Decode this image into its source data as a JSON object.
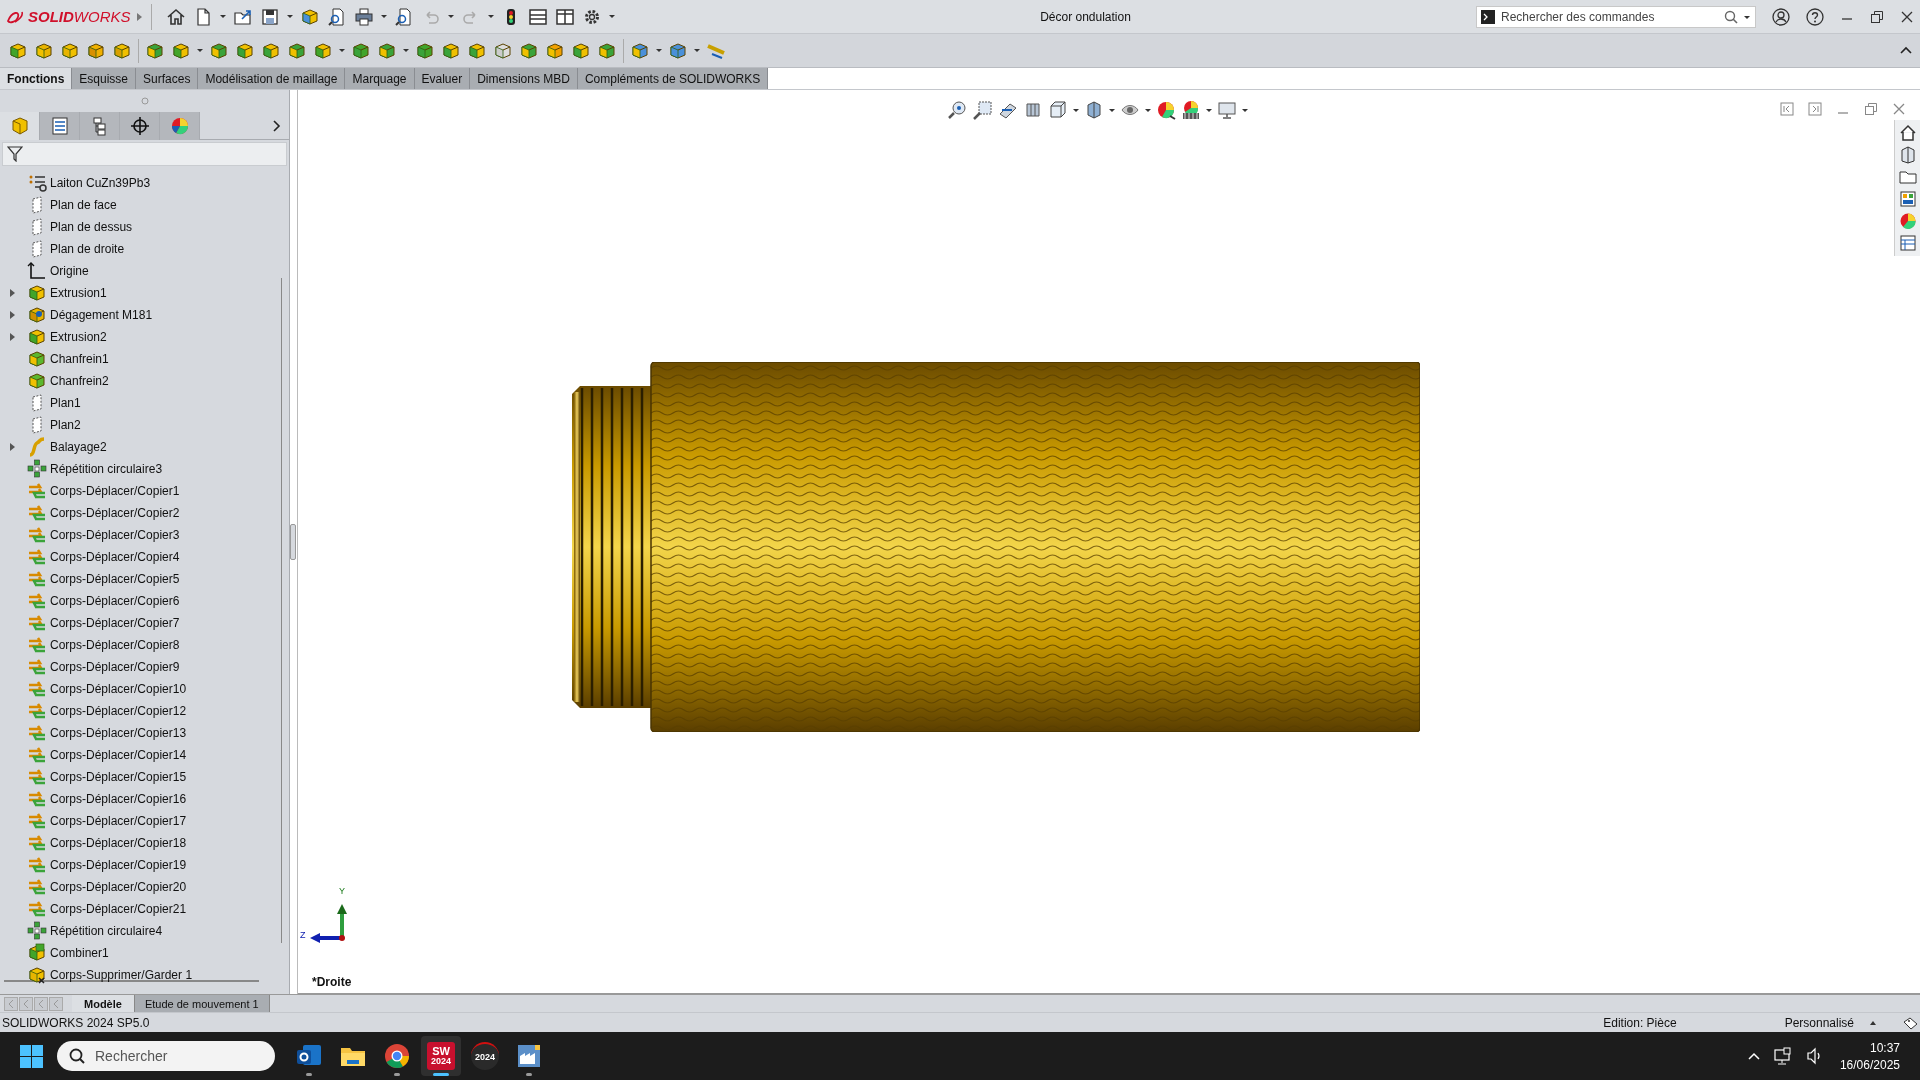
{
  "app": {
    "logo": "**SOLID**WORKS",
    "title": "Décor ondulation",
    "search": {
      "placeholder": "Rechercher des commandes"
    }
  },
  "command_tabs": [
    {
      "label": "Fonctions",
      "selected": true
    },
    {
      "label": "Esquisse",
      "selected": false
    },
    {
      "label": "Surfaces",
      "selected": false
    },
    {
      "label": "Modélisation de maillage",
      "selected": false
    },
    {
      "label": "Marquage",
      "selected": false
    },
    {
      "label": "Evaluer",
      "selected": false
    },
    {
      "label": "Dimensions MBD",
      "selected": false
    },
    {
      "label": "Compléments de SOLIDWORKS",
      "selected": false
    }
  ],
  "panel_tabs": [
    {
      "kind": "features",
      "selected": true
    },
    {
      "kind": "properties",
      "selected": false
    },
    {
      "kind": "configurations",
      "selected": false
    },
    {
      "kind": "dimxpert",
      "selected": false
    },
    {
      "kind": "appearance",
      "selected": false
    }
  ],
  "feature_tree": {
    "items": [
      {
        "label": "Laiton CuZn39Pb3",
        "kind": "material",
        "collapsed": false
      },
      {
        "label": "Plan de face",
        "kind": "plane",
        "collapsed": false
      },
      {
        "label": "Plan de dessus",
        "kind": "plane",
        "collapsed": false
      },
      {
        "label": "Plan de droite",
        "kind": "plane",
        "collapsed": false
      },
      {
        "label": "Origine",
        "kind": "origin",
        "collapsed": false
      },
      {
        "label": "Extrusion1",
        "kind": "extrude",
        "collapsed": true
      },
      {
        "label": "Dégagement M181",
        "kind": "hole",
        "collapsed": true
      },
      {
        "label": "Extrusion2",
        "kind": "extrude",
        "collapsed": true
      },
      {
        "label": "Chanfrein1",
        "kind": "chamfer",
        "collapsed": false
      },
      {
        "label": "Chanfrein2",
        "kind": "chamfer",
        "collapsed": false
      },
      {
        "label": "Plan1",
        "kind": "plane",
        "collapsed": false
      },
      {
        "label": "Plan2",
        "kind": "plane",
        "collapsed": false
      },
      {
        "label": "Balayage2",
        "kind": "sweep",
        "collapsed": true
      },
      {
        "label": "Répétition circulaire3",
        "kind": "pattern",
        "collapsed": false
      },
      {
        "label": "Corps-Déplacer/Copier1",
        "kind": "move",
        "collapsed": false
      },
      {
        "label": "Corps-Déplacer/Copier2",
        "kind": "move",
        "collapsed": false
      },
      {
        "label": "Corps-Déplacer/Copier3",
        "kind": "move",
        "collapsed": false
      },
      {
        "label": "Corps-Déplacer/Copier4",
        "kind": "move",
        "collapsed": false
      },
      {
        "label": "Corps-Déplacer/Copier5",
        "kind": "move",
        "collapsed": false
      },
      {
        "label": "Corps-Déplacer/Copier6",
        "kind": "move",
        "collapsed": false
      },
      {
        "label": "Corps-Déplacer/Copier7",
        "kind": "move",
        "collapsed": false
      },
      {
        "label": "Corps-Déplacer/Copier8",
        "kind": "move",
        "collapsed": false
      },
      {
        "label": "Corps-Déplacer/Copier9",
        "kind": "move",
        "collapsed": false
      },
      {
        "label": "Corps-Déplacer/Copier10",
        "kind": "move",
        "collapsed": false
      },
      {
        "label": "Corps-Déplacer/Copier12",
        "kind": "move",
        "collapsed": false
      },
      {
        "label": "Corps-Déplacer/Copier13",
        "kind": "move",
        "collapsed": false
      },
      {
        "label": "Corps-Déplacer/Copier14",
        "kind": "move",
        "collapsed": false
      },
      {
        "label": "Corps-Déplacer/Copier15",
        "kind": "move",
        "collapsed": false
      },
      {
        "label": "Corps-Déplacer/Copier16",
        "kind": "move",
        "collapsed": false
      },
      {
        "label": "Corps-Déplacer/Copier17",
        "kind": "move",
        "collapsed": false
      },
      {
        "label": "Corps-Déplacer/Copier18",
        "kind": "move",
        "collapsed": false
      },
      {
        "label": "Corps-Déplacer/Copier19",
        "kind": "move",
        "collapsed": false
      },
      {
        "label": "Corps-Déplacer/Copier20",
        "kind": "move",
        "collapsed": false
      },
      {
        "label": "Corps-Déplacer/Copier21",
        "kind": "move",
        "collapsed": false
      },
      {
        "label": "Répétition circulaire4",
        "kind": "pattern",
        "collapsed": false
      },
      {
        "label": "Combiner1",
        "kind": "combine",
        "collapsed": false
      },
      {
        "label": "Corps-Supprimer/Garder 1",
        "kind": "delete",
        "collapsed": false
      }
    ]
  },
  "viewport": {
    "view_name": "*Droite",
    "triad": {
      "y_label": "Y",
      "z_label": "Z"
    }
  },
  "bottom_tabs": [
    {
      "label": "Modèle",
      "selected": true
    },
    {
      "label": "Etude de mouvement 1",
      "selected": false
    }
  ],
  "status_bar": {
    "version": "SOLIDWORKS 2024 SP5.0",
    "mode": "Edition: Pièce",
    "units": "Personnalisé"
  },
  "taskbar": {
    "search": {
      "placeholder": "Rechercher"
    },
    "apps": [
      {
        "kind": "mail",
        "running": true,
        "selected": false
      },
      {
        "kind": "folder",
        "running": false,
        "selected": false
      },
      {
        "kind": "browser",
        "running": true,
        "selected": false
      },
      {
        "kind": "cad",
        "mark": "SW",
        "badge": "2024",
        "running": true,
        "selected": true
      },
      {
        "kind": "cad-tool",
        "badge": "2024",
        "running": false,
        "selected": false
      },
      {
        "kind": "factory",
        "running": true,
        "selected": false
      }
    ],
    "time": "10:37",
    "date": "16/06/2025"
  }
}
